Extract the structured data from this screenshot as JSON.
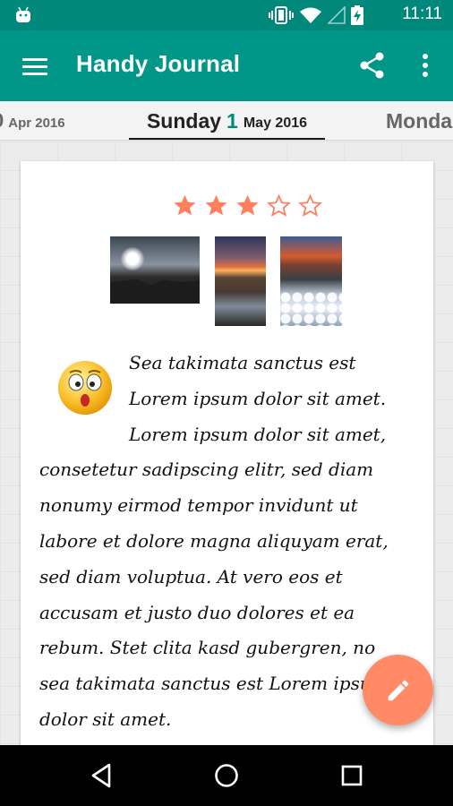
{
  "status_bar": {
    "time": "11:11",
    "icons": [
      "android-icon",
      "vibrate-icon",
      "wifi-icon",
      "signal-icon",
      "battery-charging-icon"
    ]
  },
  "toolbar": {
    "title": "Handy Journal",
    "icons": [
      "menu-icon",
      "share-icon",
      "more-vert-icon"
    ]
  },
  "date_tabs": {
    "previous": {
      "num": "0",
      "month": "Apr 2016"
    },
    "current": {
      "day": "Sunday",
      "num": "1",
      "month": "May 2016"
    },
    "next": {
      "day": "Monda"
    }
  },
  "entry": {
    "rating": {
      "value": 3,
      "max": 5
    },
    "photos": [
      "sunset-silhouette-photo",
      "sunset-coast-photo",
      "snow-stones-photo"
    ],
    "mood_icon": "surprised-emoji-icon",
    "text": "Sea takimata sanctus est Lorem ipsum dolor sit amet. Lorem ipsum dolor sit amet, consetetur sadipscing elitr, sed diam nonumy eirmod tempor invidunt ut labore et dolore magna aliquyam erat, sed diam voluptua. At vero eos et accusam et justo duo dolores et ea rebum. Stet clita kasd gubergren, no sea takimata sanctus est Lorem ipsum dolor sit amet."
  },
  "fab": {
    "icon": "edit-pencil-icon"
  },
  "navigation_bar": {
    "icons": [
      "back-icon",
      "home-icon",
      "recents-icon"
    ]
  },
  "colors": {
    "primary_dark": "#00897b",
    "primary": "#009688",
    "accent": "#ff8a65",
    "star": "#ff7f5e"
  }
}
